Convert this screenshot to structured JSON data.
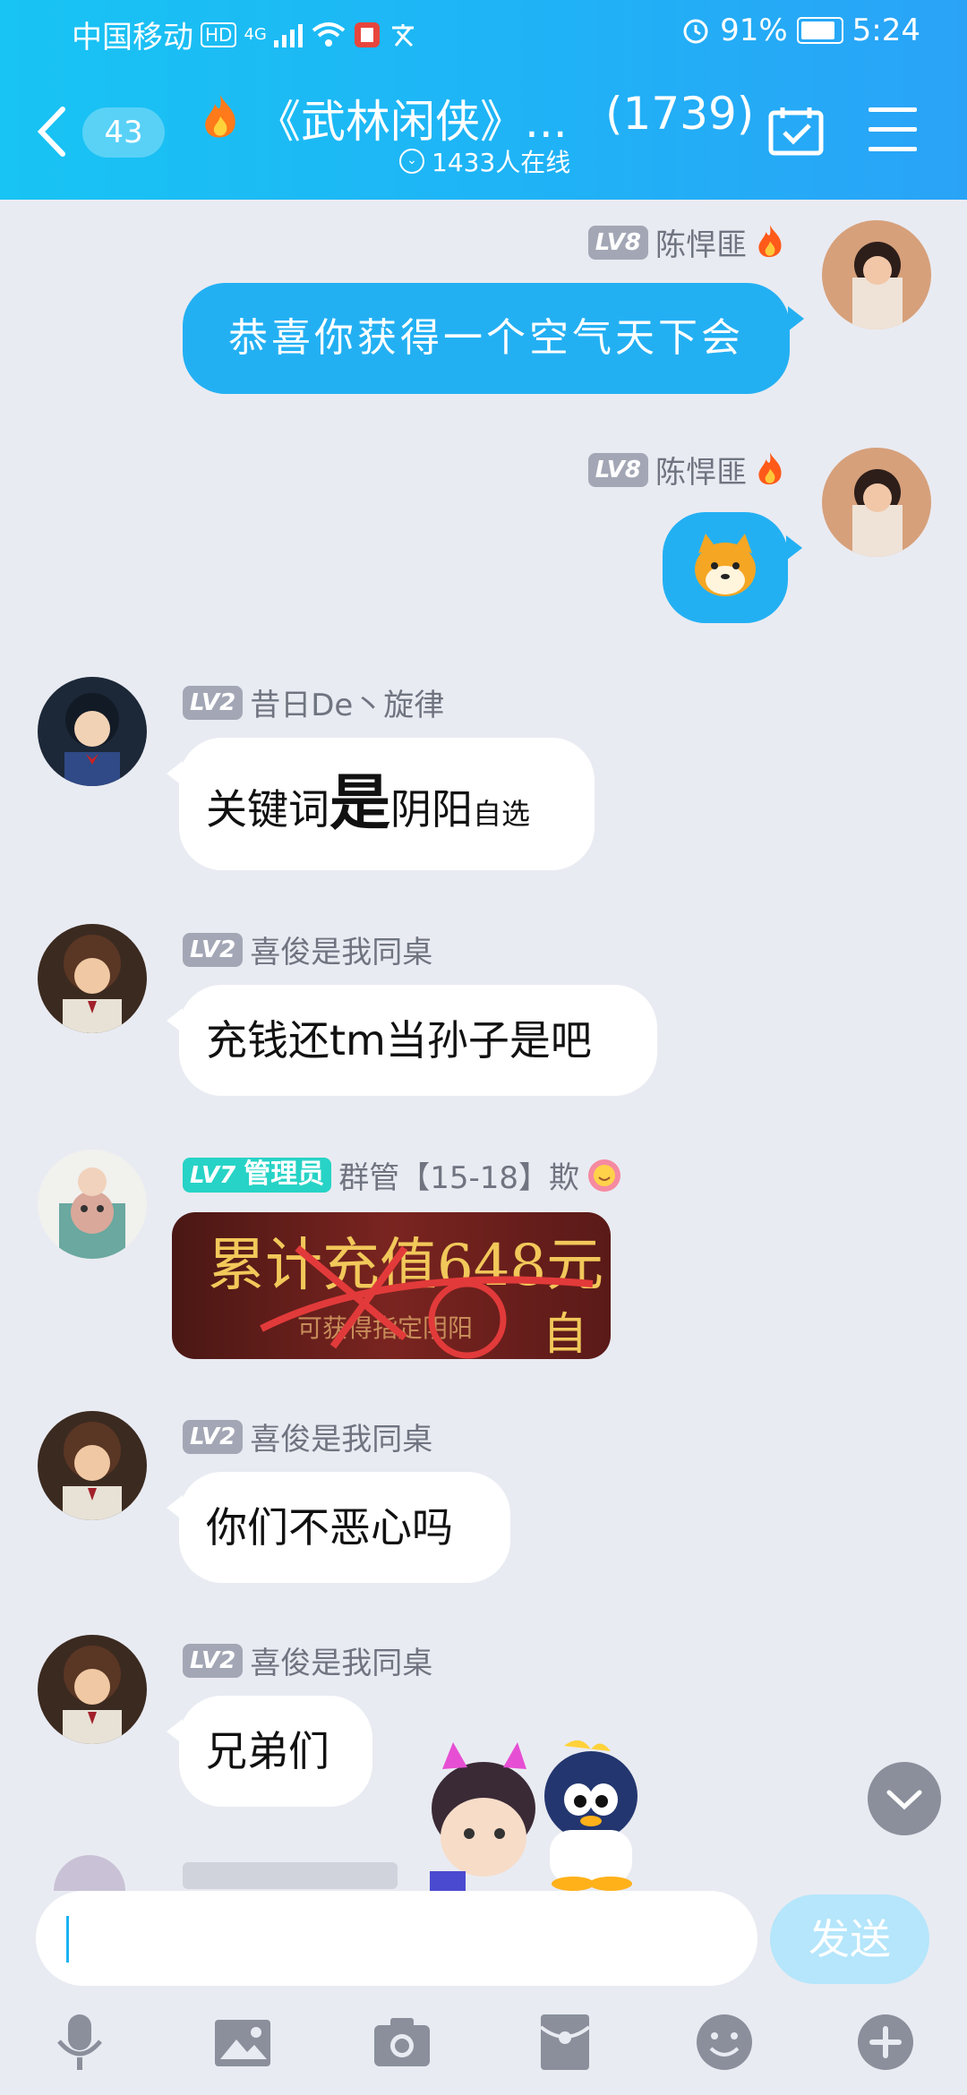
{
  "status_bar": {
    "carrier": "中国移动",
    "hd": "HD",
    "network": "4G",
    "battery": "91%",
    "time": "5:24"
  },
  "header": {
    "back_count": "43",
    "title": "《武林闲侠》...",
    "member_count": "(1739)",
    "online_text": "1433人在线"
  },
  "messages": [
    {
      "side": "out",
      "level": "LV8",
      "sender": "陈悍匪",
      "text": "恭喜你获得一个空气天下会"
    },
    {
      "side": "out",
      "level": "LV8",
      "sender": "陈悍匪",
      "type": "sticker"
    },
    {
      "side": "in",
      "level": "LV2",
      "sender": "昔日De丶旋律",
      "text_parts": [
        "关键词",
        "是",
        "阴阳",
        "自选"
      ]
    },
    {
      "side": "in",
      "level": "LV2",
      "sender": "喜俊是我同桌",
      "text": "充钱还tm当孙子是吧"
    },
    {
      "side": "in",
      "level": "LV7",
      "role": "管理员",
      "sender": "群管【15-18】欺",
      "type": "image",
      "image_text": [
        "累计充值648元",
        "可获得指定阴阳",
        "自选"
      ]
    },
    {
      "side": "in",
      "level": "LV2",
      "sender": "喜俊是我同桌",
      "text": "你们不恶心吗"
    },
    {
      "side": "in",
      "level": "LV2",
      "sender": "喜俊是我同桌",
      "text": "兄弟们"
    }
  ],
  "composer": {
    "placeholder": "",
    "send_label": "发送"
  },
  "toolbar_icons": [
    "mic-icon",
    "image-icon",
    "camera-icon",
    "red-packet-icon",
    "emoji-icon",
    "plus-icon"
  ],
  "colors": {
    "header_gradient_start": "#18c4f3",
    "header_gradient_end": "#2aa3f7",
    "outgoing_bubble": "#23b0f3",
    "background": "#e9ebf2",
    "admin_badge": "#27d3c6"
  }
}
